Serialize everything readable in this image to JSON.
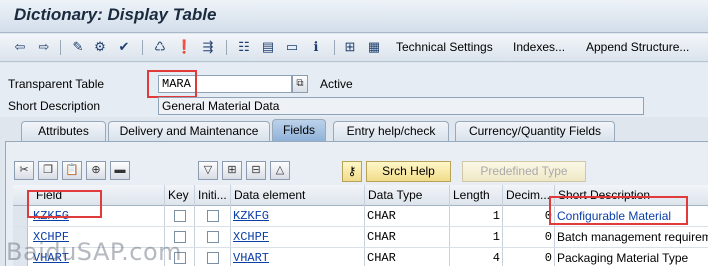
{
  "window": {
    "title": "Dictionary: Display Table"
  },
  "toolbar": {
    "technical_settings": "Technical Settings",
    "indexes": "Indexes...",
    "append_structure": "Append Structure..."
  },
  "header": {
    "transparent_table_label": "Transparent Table",
    "table_name": "MARA",
    "status": "Active",
    "short_description_label": "Short Description",
    "short_description": "General Material Data"
  },
  "tabs": [
    {
      "label": "Attributes",
      "active": false
    },
    {
      "label": "Delivery and Maintenance",
      "active": false
    },
    {
      "label": "Fields",
      "active": true
    },
    {
      "label": "Entry help/check",
      "active": false
    },
    {
      "label": "Currency/Quantity Fields",
      "active": false
    }
  ],
  "buttons": {
    "srch_help": "Srch Help",
    "predefined_type": "Predefined Type"
  },
  "grid": {
    "columns": [
      "Field",
      "Key",
      "Initi...",
      "Data element",
      "Data Type",
      "Length",
      "Decim...",
      "Short Description"
    ],
    "rows": [
      {
        "field": "KZKFG",
        "data_element": "KZKFG",
        "data_type": "CHAR",
        "length": "1",
        "decimals": "0",
        "short_description": "Configurable Material"
      },
      {
        "field": "XCHPF",
        "data_element": "XCHPF",
        "data_type": "CHAR",
        "length": "1",
        "decimals": "0",
        "short_description": "Batch management requirem"
      },
      {
        "field": "VHART",
        "data_element": "VHART",
        "data_type": "CHAR",
        "length": "4",
        "decimals": "0",
        "short_description": "Packaging Material Type"
      }
    ]
  },
  "watermark": "BaiduSAP.com",
  "colors": {
    "highlight": "#e03a3a",
    "link": "#0b3fa8"
  }
}
